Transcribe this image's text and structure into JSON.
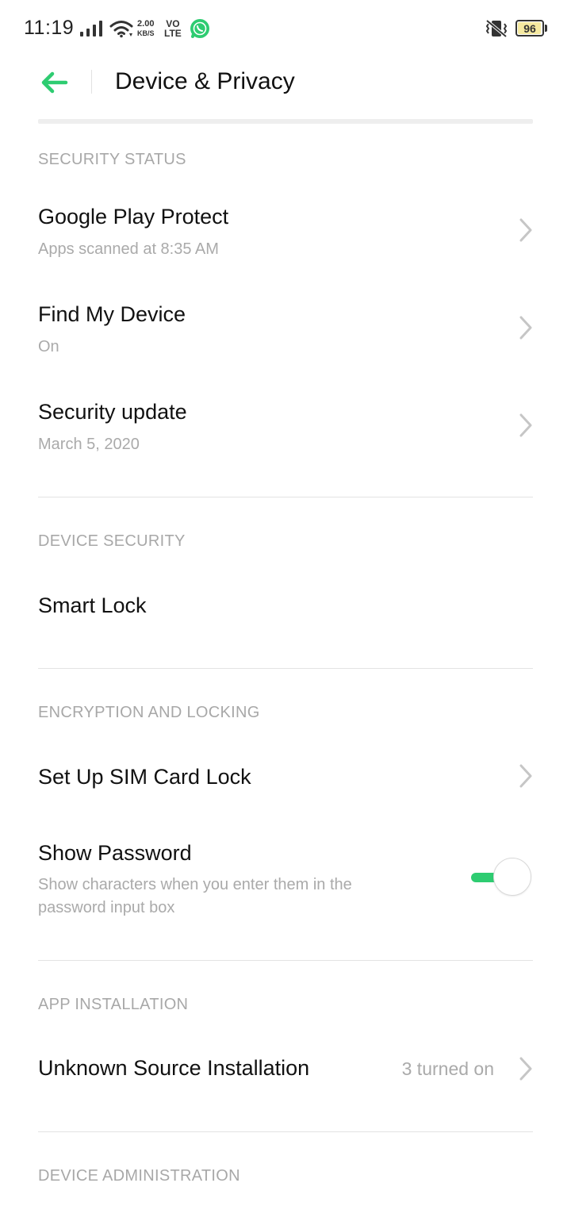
{
  "status_bar": {
    "time": "11:19",
    "net_speed_value": "2.00",
    "net_speed_unit": "KB/S",
    "volte_top": "VO",
    "volte_bottom": "LTE",
    "battery": "96",
    "battery_level": 0.96,
    "icons": [
      "signal-icon",
      "wifi-icon",
      "whatsapp-icon",
      "vibrate-icon",
      "battery-icon"
    ]
  },
  "header": {
    "title": "Device & Privacy",
    "back_icon": "back-arrow-icon"
  },
  "colors": {
    "accent": "#2ecc71",
    "section_header": "#a8a8a8",
    "subtitle": "#aaaaaa",
    "title": "#111111"
  },
  "sections": {
    "security_status": {
      "header": "SECURITY STATUS",
      "items": [
        {
          "title": "Google Play Protect",
          "subtitle": "Apps scanned at 8:35 AM"
        },
        {
          "title": "Find My Device",
          "subtitle": "On"
        },
        {
          "title": "Security update",
          "subtitle": "March 5, 2020"
        }
      ]
    },
    "device_security": {
      "header": "DEVICE SECURITY",
      "items": [
        {
          "title": "Smart Lock"
        }
      ]
    },
    "encryption": {
      "header": "ENCRYPTION AND LOCKING",
      "items": [
        {
          "title": "Set Up SIM Card Lock"
        },
        {
          "title": "Show Password",
          "subtitle": "Show characters when you enter them in the password input box",
          "toggle_on": true
        }
      ]
    },
    "app_installation": {
      "header": "APP INSTALLATION",
      "items": [
        {
          "title": "Unknown Source Installation",
          "value": "3 turned on"
        }
      ]
    },
    "device_administration": {
      "header": "DEVICE ADMINISTRATION"
    }
  }
}
